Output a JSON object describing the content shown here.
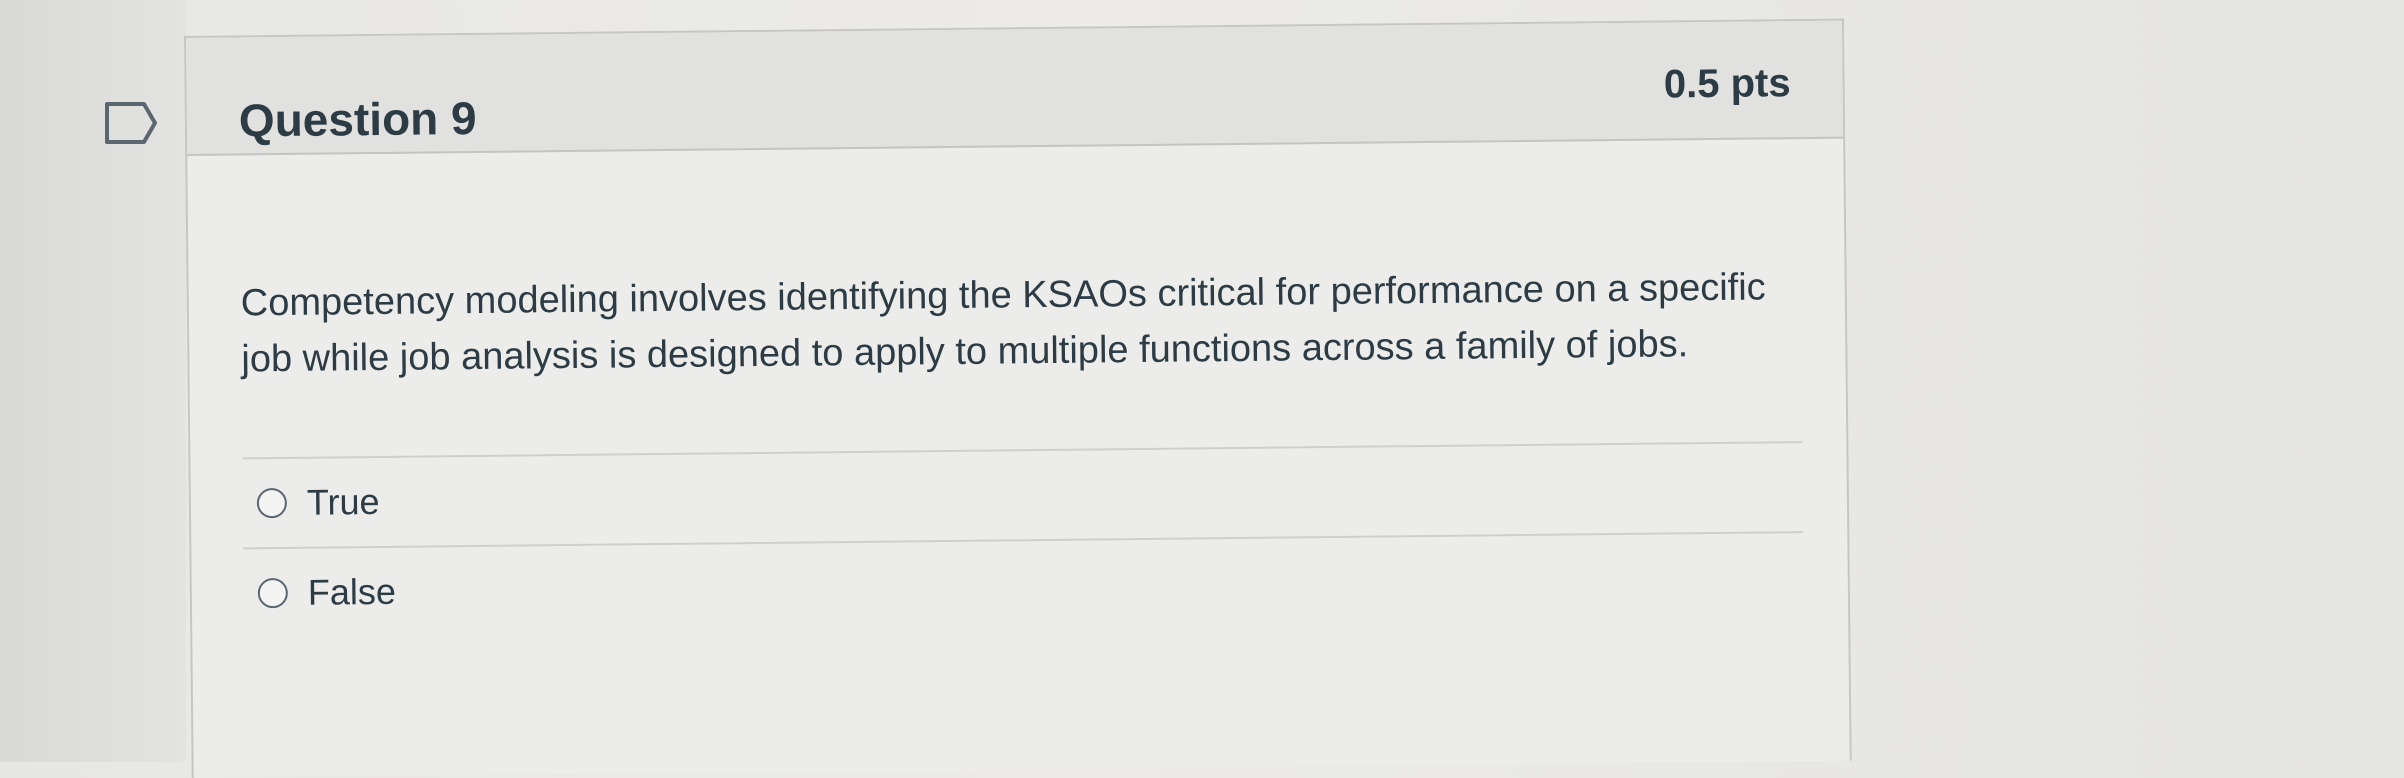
{
  "question": {
    "title": "Question 9",
    "points": "0.5 pts",
    "text": "Competency modeling involves identifying the KSAOs critical for performance on a specific job while job analysis is designed to apply to multiple functions across a family of jobs.",
    "answers": [
      {
        "label": "True",
        "selected": false
      },
      {
        "label": "False",
        "selected": false
      }
    ]
  },
  "icons": {
    "flag": "bookmark-flag-icon",
    "radio": "radio-button-icon"
  },
  "colors": {
    "text": "#2d3b45",
    "header_bg": "#e1e1df",
    "border": "#c6c6c4"
  }
}
